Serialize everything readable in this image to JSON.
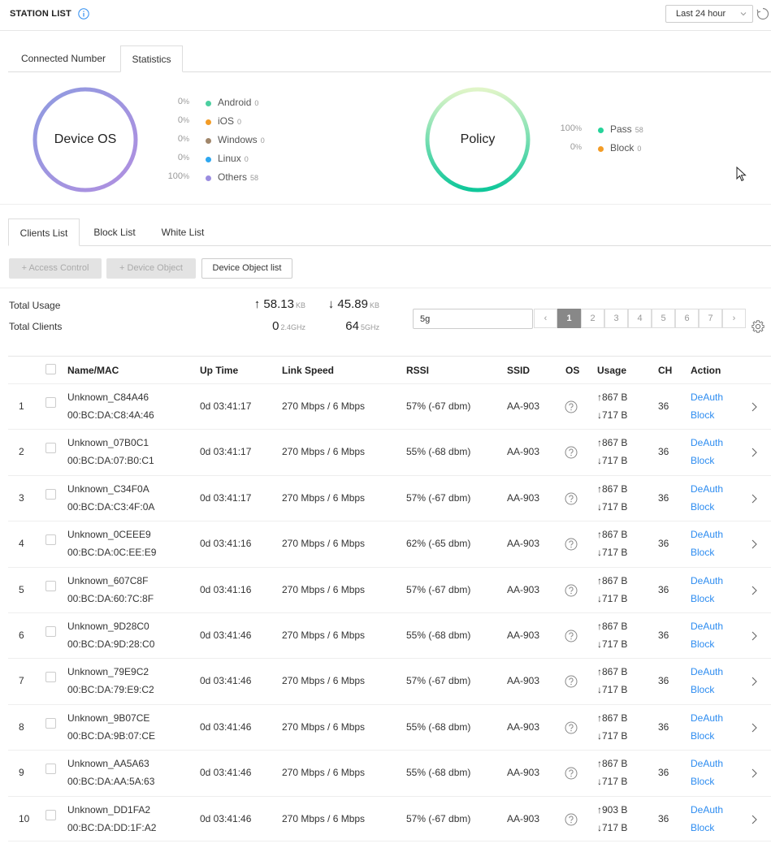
{
  "header": {
    "title": "STATION LIST",
    "time_range": "Last 24 hour"
  },
  "top_tabs": [
    "Connected Number",
    "Statistics"
  ],
  "active_top_tab": "Statistics",
  "os_chart": {
    "label": "Device OS",
    "items": [
      {
        "pct": "0",
        "unit": "%",
        "name": "Android",
        "count": "0",
        "color": "#4ccfa0"
      },
      {
        "pct": "0",
        "unit": "%",
        "name": "iOS",
        "count": "0",
        "color": "#f39c26"
      },
      {
        "pct": "0",
        "unit": "%",
        "name": "Windows",
        "count": "0",
        "color": "#a0866a"
      },
      {
        "pct": "0",
        "unit": "%",
        "name": "Linux",
        "count": "0",
        "color": "#2ea7f0"
      },
      {
        "pct": "100",
        "unit": "%",
        "name": "Others",
        "count": "58",
        "color": "#9b8de0"
      }
    ]
  },
  "policy_chart": {
    "label": "Policy",
    "items": [
      {
        "pct": "100",
        "unit": "%",
        "name": "Pass",
        "count": "58",
        "color": "#26d39a"
      },
      {
        "pct": "0",
        "unit": "%",
        "name": "Block",
        "count": "0",
        "color": "#f39c26"
      }
    ]
  },
  "list_tabs": [
    "Clients List",
    "Block List",
    "White List"
  ],
  "active_list_tab": "Clients List",
  "toolbar": {
    "access_control": "+ Access Control",
    "device_object": "+ Device Object",
    "device_object_list": "Device Object list"
  },
  "summary": {
    "total_usage_label": "Total Usage",
    "total_clients_label": "Total Clients",
    "upload": "↑ 58.13",
    "upload_unit": "KB",
    "download": "↓ 45.89",
    "download_unit": "KB",
    "clients_24": "0",
    "clients_24_unit": "2.4GHz",
    "clients_5": "64",
    "clients_5_unit": "5GHz"
  },
  "search": {
    "value": "5g"
  },
  "pagination": {
    "prev": "‹",
    "next": "›",
    "pages": [
      "1",
      "2",
      "3",
      "4",
      "5",
      "6",
      "7"
    ],
    "current": "1"
  },
  "table": {
    "columns": {
      "name": "Name/MAC",
      "uptime": "Up Time",
      "speed": "Link Speed",
      "rssi": "RSSI",
      "ssid": "SSID",
      "os": "OS",
      "usage": "Usage",
      "ch": "CH",
      "action": "Action"
    },
    "deauth_label": "DeAuth",
    "block_label": "Block",
    "rows": [
      {
        "idx": "1",
        "name": "Unknown_C84A46",
        "mac": "00:BC:DA:C8:4A:46",
        "uptime": "0d 03:41:17",
        "speed": "270 Mbps / 6 Mbps",
        "rssi": "57% (-67 dbm)",
        "ssid": "AA-903",
        "up": "↑867 B",
        "down": "↓717 B",
        "ch": "36"
      },
      {
        "idx": "2",
        "name": "Unknown_07B0C1",
        "mac": "00:BC:DA:07:B0:C1",
        "uptime": "0d 03:41:17",
        "speed": "270 Mbps / 6 Mbps",
        "rssi": "55% (-68 dbm)",
        "ssid": "AA-903",
        "up": "↑867 B",
        "down": "↓717 B",
        "ch": "36"
      },
      {
        "idx": "3",
        "name": "Unknown_C34F0A",
        "mac": "00:BC:DA:C3:4F:0A",
        "uptime": "0d 03:41:17",
        "speed": "270 Mbps / 6 Mbps",
        "rssi": "57% (-67 dbm)",
        "ssid": "AA-903",
        "up": "↑867 B",
        "down": "↓717 B",
        "ch": "36"
      },
      {
        "idx": "4",
        "name": "Unknown_0CEEE9",
        "mac": "00:BC:DA:0C:EE:E9",
        "uptime": "0d 03:41:16",
        "speed": "270 Mbps / 6 Mbps",
        "rssi": "62% (-65 dbm)",
        "ssid": "AA-903",
        "up": "↑867 B",
        "down": "↓717 B",
        "ch": "36"
      },
      {
        "idx": "5",
        "name": "Unknown_607C8F",
        "mac": "00:BC:DA:60:7C:8F",
        "uptime": "0d 03:41:16",
        "speed": "270 Mbps / 6 Mbps",
        "rssi": "57% (-67 dbm)",
        "ssid": "AA-903",
        "up": "↑867 B",
        "down": "↓717 B",
        "ch": "36"
      },
      {
        "idx": "6",
        "name": "Unknown_9D28C0",
        "mac": "00:BC:DA:9D:28:C0",
        "uptime": "0d 03:41:46",
        "speed": "270 Mbps / 6 Mbps",
        "rssi": "55% (-68 dbm)",
        "ssid": "AA-903",
        "up": "↑867 B",
        "down": "↓717 B",
        "ch": "36"
      },
      {
        "idx": "7",
        "name": "Unknown_79E9C2",
        "mac": "00:BC:DA:79:E9:C2",
        "uptime": "0d 03:41:46",
        "speed": "270 Mbps / 6 Mbps",
        "rssi": "57% (-67 dbm)",
        "ssid": "AA-903",
        "up": "↑867 B",
        "down": "↓717 B",
        "ch": "36"
      },
      {
        "idx": "8",
        "name": "Unknown_9B07CE",
        "mac": "00:BC:DA:9B:07:CE",
        "uptime": "0d 03:41:46",
        "speed": "270 Mbps / 6 Mbps",
        "rssi": "55% (-68 dbm)",
        "ssid": "AA-903",
        "up": "↑867 B",
        "down": "↓717 B",
        "ch": "36"
      },
      {
        "idx": "9",
        "name": "Unknown_AA5A63",
        "mac": "00:BC:DA:AA:5A:63",
        "uptime": "0d 03:41:46",
        "speed": "270 Mbps / 6 Mbps",
        "rssi": "55% (-68 dbm)",
        "ssid": "AA-903",
        "up": "↑867 B",
        "down": "↓717 B",
        "ch": "36"
      },
      {
        "idx": "10",
        "name": "Unknown_DD1FA2",
        "mac": "00:BC:DA:DD:1F:A2",
        "uptime": "0d 03:41:46",
        "speed": "270 Mbps / 6 Mbps",
        "rssi": "57% (-67 dbm)",
        "ssid": "AA-903",
        "up": "↑903 B",
        "down": "↓717 B",
        "ch": "36"
      }
    ]
  }
}
